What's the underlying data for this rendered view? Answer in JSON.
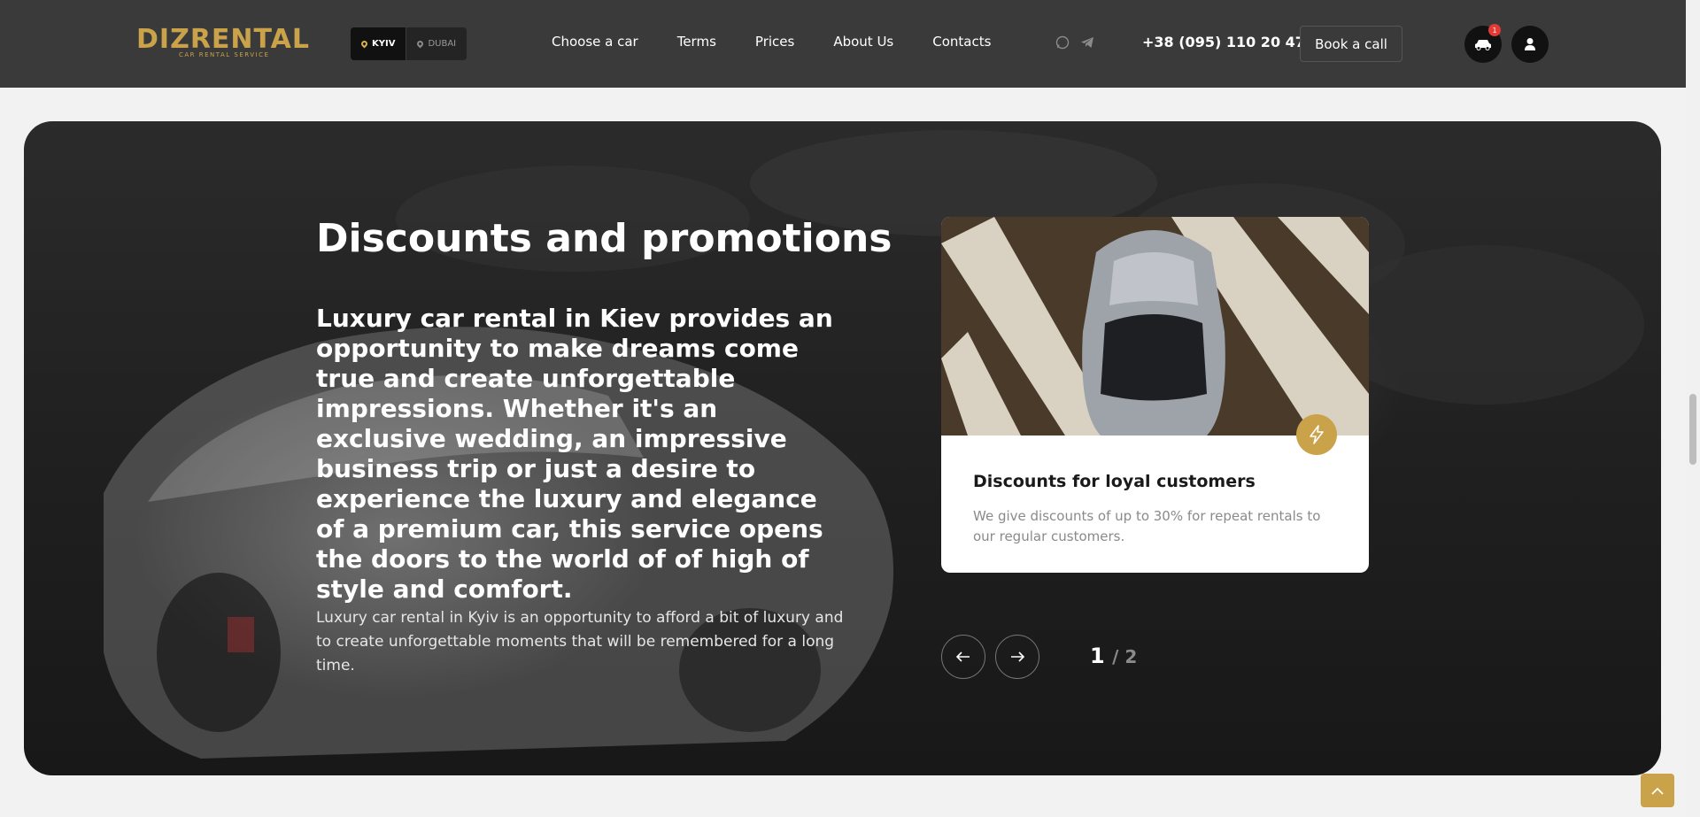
{
  "header": {
    "logo_text": "DIZRENTAL",
    "logo_subtitle": "CAR RENTAL SERVICE",
    "cities": [
      {
        "label": "KYIV",
        "active": true
      },
      {
        "label": "DUBAI",
        "active": false
      }
    ],
    "nav": [
      "Choose a car",
      "Terms",
      "Prices",
      "About Us",
      "Contacts"
    ],
    "social_icons": [
      "whatsapp-icon",
      "telegram-icon"
    ],
    "phone": "+38 (095) 110 20 47",
    "book_call": "Book a call",
    "cart_count": "1"
  },
  "promo": {
    "title": "Discounts and promotions",
    "lead": "Luxury car rental in Kiev provides an opportunity to make dreams come true and create unforgettable impressions. Whether it's an exclusive wedding, an impressive business trip or just a desire to experience the luxury and elegance of a premium car, this service opens the doors to the world of of high of style and comfort.",
    "text": "Luxury car rental in Kyiv is an opportunity to afford a bit of luxury and to create unforgettable moments that will be remembered for a long time.",
    "card": {
      "title": "Discounts for loyal customers",
      "text": "We give discounts of up to 30% for repeat rentals to our regular customers."
    },
    "pager": {
      "current": "1",
      "total": "/ 2"
    }
  },
  "colors": {
    "accent": "#c9a24a",
    "header_bg": "#3a3a3a",
    "badge": "#e53935"
  }
}
